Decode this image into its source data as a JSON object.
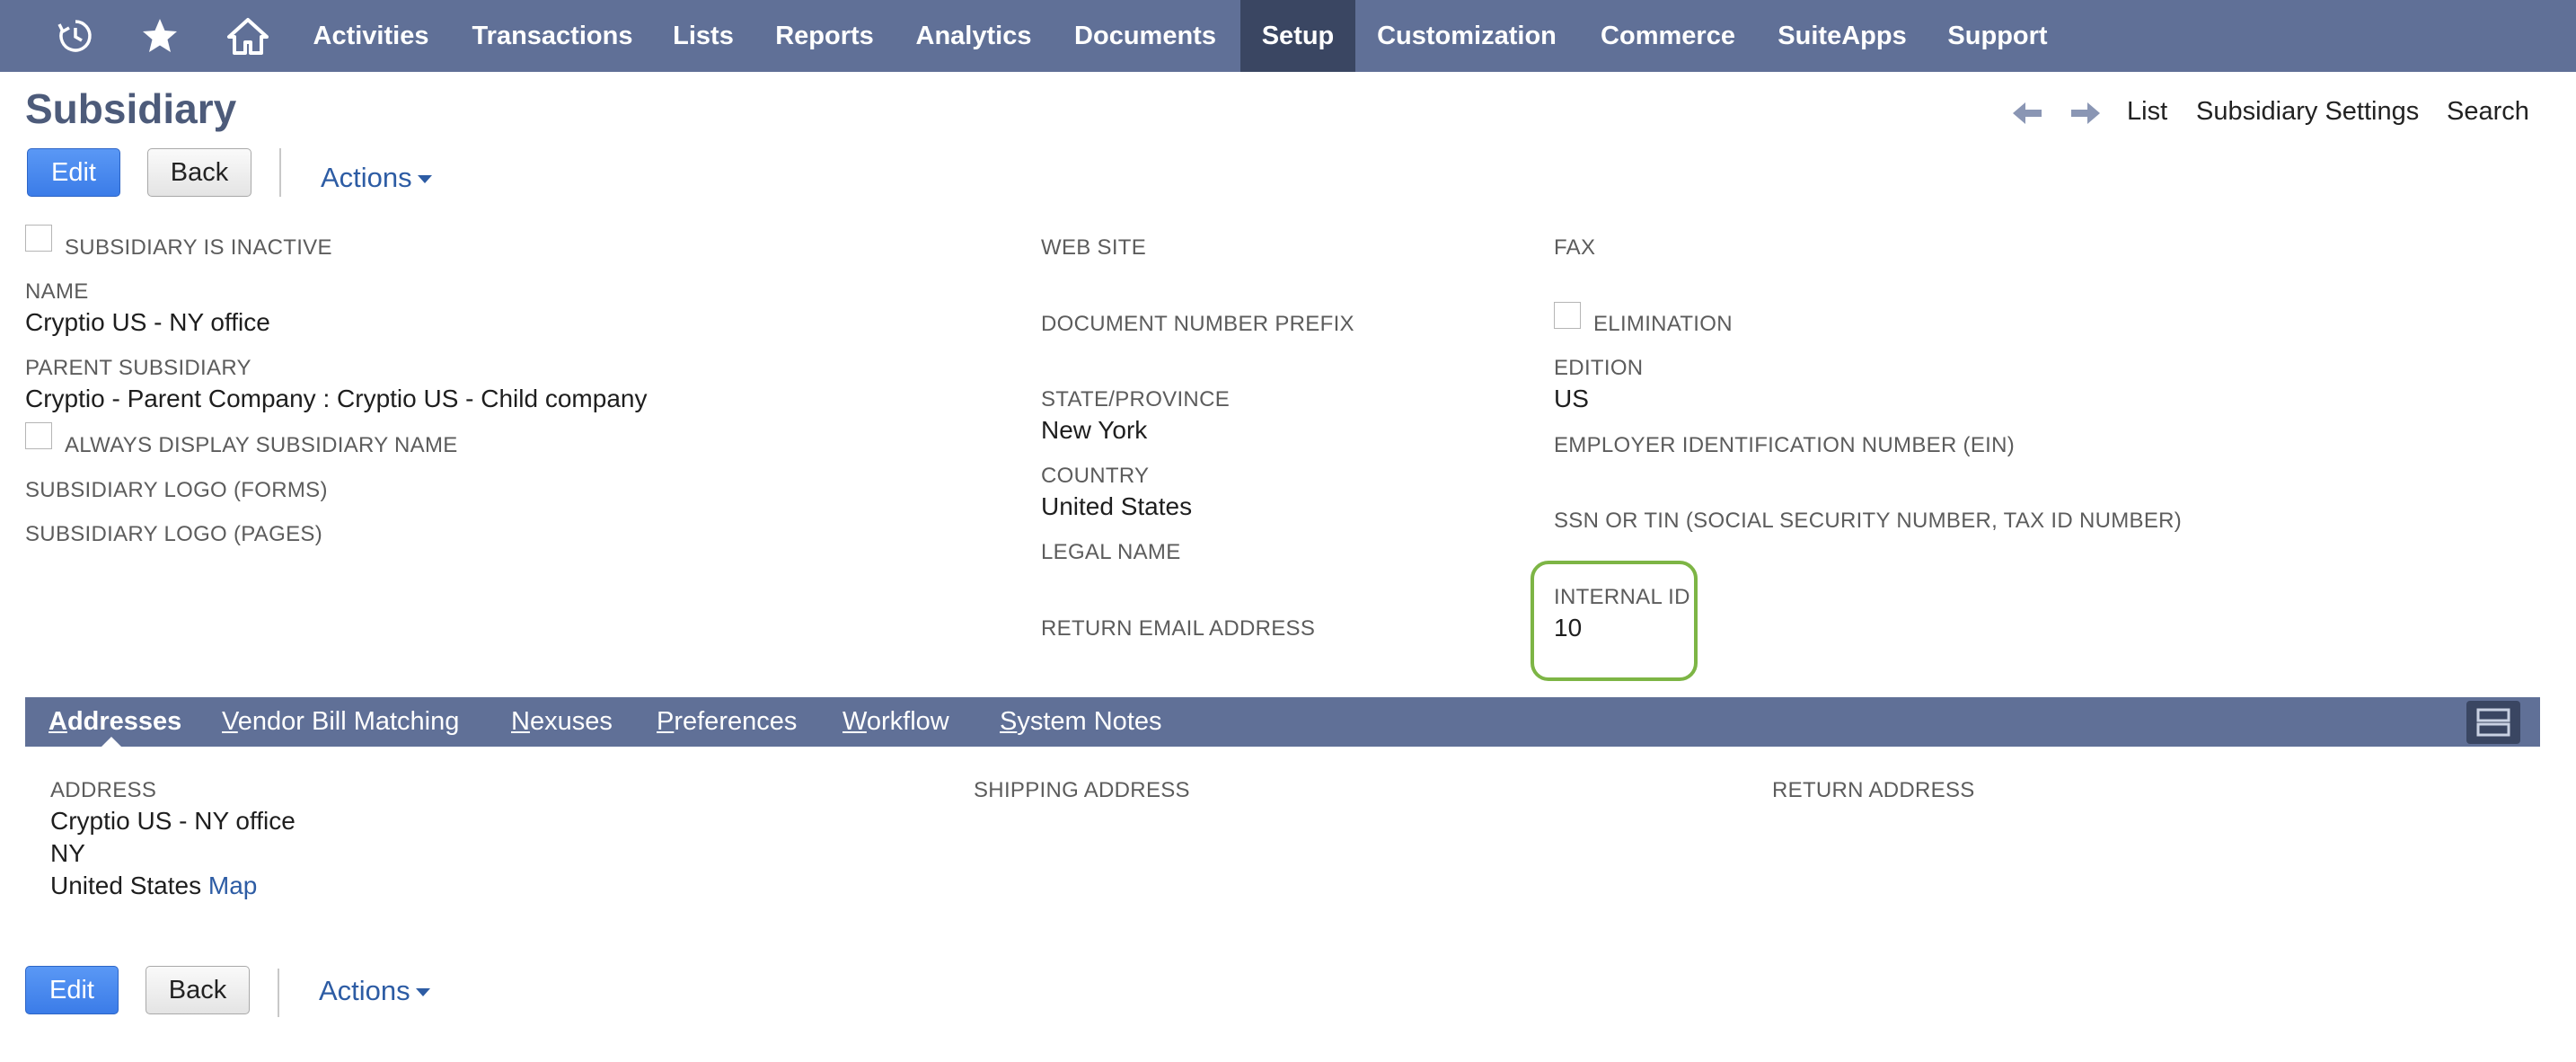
{
  "nav": {
    "icons": [
      "recent-records-icon",
      "star-icon",
      "home-icon"
    ],
    "items": [
      "Activities",
      "Transactions",
      "Lists",
      "Reports",
      "Analytics",
      "Documents",
      "Setup",
      "Customization",
      "Commerce",
      "SuiteApps",
      "Support"
    ],
    "active": "Setup"
  },
  "page": {
    "title": "Subsidiary",
    "nav_links": [
      "List",
      "Subsidiary Settings",
      "Search"
    ]
  },
  "buttons": {
    "edit": "Edit",
    "back": "Back",
    "actions": "Actions"
  },
  "fields": {
    "inactive_label": "SUBSIDIARY IS INACTIVE",
    "name_label": "NAME",
    "name_value": "Cryptio US - NY office",
    "parent_label": "PARENT SUBSIDIARY",
    "parent_value": "Cryptio - Parent Company : Cryptio US - Child company",
    "always_display_label": "ALWAYS DISPLAY SUBSIDIARY NAME",
    "logo_forms_label": "SUBSIDIARY LOGO (FORMS)",
    "logo_pages_label": "SUBSIDIARY LOGO (PAGES)",
    "website_label": "WEB SITE",
    "doc_prefix_label": "DOCUMENT NUMBER PREFIX",
    "state_label": "STATE/PROVINCE",
    "state_value": "New York",
    "country_label": "COUNTRY",
    "country_value": "United States",
    "legal_name_label": "LEGAL NAME",
    "return_email_label": "RETURN EMAIL ADDRESS",
    "fax_label": "FAX",
    "elimination_label": "ELIMINATION",
    "edition_label": "EDITION",
    "edition_value": "US",
    "ein_label": "EMPLOYER IDENTIFICATION NUMBER (EIN)",
    "ssn_label": "SSN OR TIN (SOCIAL SECURITY NUMBER, TAX ID NUMBER)",
    "internal_id_label": "INTERNAL ID",
    "internal_id_value": "10"
  },
  "tabs": [
    {
      "first": "A",
      "rest": "ddresses"
    },
    {
      "first": "V",
      "rest": "endor Bill Matching"
    },
    {
      "first": "N",
      "rest": "exuses"
    },
    {
      "first": "P",
      "rest": "references"
    },
    {
      "first": "W",
      "rest": "orkflow"
    },
    {
      "first": "S",
      "rest": "ystem Notes"
    }
  ],
  "addresses": {
    "address_label": "ADDRESS",
    "address_lines": [
      "Cryptio US - NY office",
      "NY",
      "United States"
    ],
    "map_link": "Map",
    "shipping_label": "SHIPPING ADDRESS",
    "return_label": "RETURN ADDRESS"
  },
  "colors": {
    "nav_bg": "#607097",
    "nav_active": "#3a4662",
    "title": "#4d5b7a",
    "link": "#2d5ca4",
    "primary_button": "#3b7ce8",
    "highlight": "#7db545"
  }
}
